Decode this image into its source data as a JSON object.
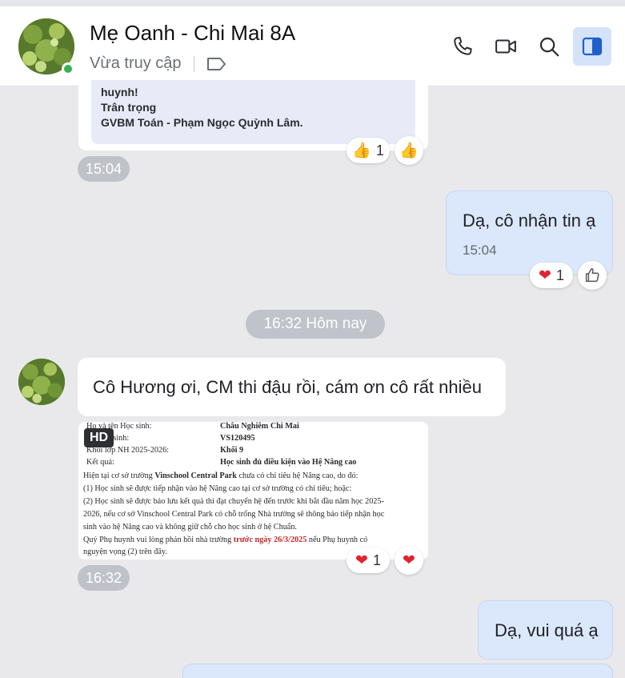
{
  "header": {
    "title": "Mẹ Oanh - Chi Mai 8A",
    "status": "Vừa truy cập"
  },
  "messages": {
    "card_top": {
      "lines": [
        "huynh!",
        "Trân trọng",
        "GVBM Toán - Phạm Ngọc Quỳnh Lâm."
      ],
      "reaction_count": "1",
      "time": "15:04"
    },
    "reply1": {
      "text": "Dạ, cô nhận tin ạ",
      "time": "15:04",
      "reaction_count": "1"
    },
    "date_separator": "16:32 Hôm nay",
    "incoming": {
      "text": "Cô Hương ơi, CM thi đậu rồi, cám ơn cô rất nhiều"
    },
    "doc_image": {
      "badge": "HD",
      "rows": [
        {
          "k": "Họ và tên Học sinh:",
          "v": "Châu Nghiêm Chi Mai"
        },
        {
          "k": "Mã học sinh:",
          "v": "VS120495"
        },
        {
          "k": "Khối lớp NH 2025-2026:",
          "v": "Khối 9"
        },
        {
          "k": "Kết quả:",
          "v": "Học sinh đủ điều kiện vào Hệ Nâng cao"
        }
      ],
      "p1a": "Hiện tại cơ sở trường ",
      "p1b": "Vinschool Central Park",
      "p1c": " chưa có chỉ tiêu hệ Nâng cao, do đó:",
      "p2": "(1) Học sinh sẽ được tiếp nhận vào hệ Nâng cao tại cơ sở trường có chỉ tiêu; hoặc:",
      "p3": "(2) Học sinh sẽ được bảo lưu kết quả thi đạt chuyển hệ đến trước khi bắt đầu năm học 2025-",
      "p4": "2026, nếu cơ sở Vinschool Central Park có chỗ trống Nhà trường sẽ thông báo tiếp nhận học",
      "p5": "sinh vào hệ Nâng cao và không giữ chỗ cho học sinh ở hệ Chuẩn.",
      "p6a": "Quý Phụ huynh vui lòng phản hồi nhà trường ",
      "p6b": "trước ngày 26/3/2025",
      "p6c": " nếu Phụ huynh có",
      "p7": "nguyện vọng (2) trên đây.",
      "reaction_count": "1",
      "time": "16:32"
    },
    "reply2": {
      "text": "Dạ, vui quá ạ"
    }
  },
  "colors": {
    "accent": "#2f6fd6",
    "outgoing_bubble": "#dbe8fb",
    "online": "#31b14f"
  },
  "icons": [
    "phone-icon",
    "video-icon",
    "search-icon",
    "side-panel-icon",
    "tag-icon",
    "thumbs-up-icon",
    "heart-icon"
  ]
}
